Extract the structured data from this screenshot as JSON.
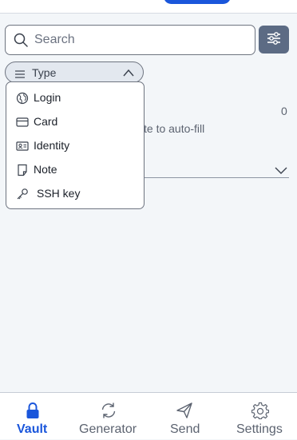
{
  "search": {
    "placeholder": "Search",
    "value": ""
  },
  "filter": {
    "type_label": "Type"
  },
  "type_menu": {
    "items": [
      {
        "label": "Login",
        "icon": "globe-icon"
      },
      {
        "label": "Card",
        "icon": "credit-card-icon"
      },
      {
        "label": "Identity",
        "icon": "id-card-icon"
      },
      {
        "label": "Note",
        "icon": "note-icon"
      },
      {
        "label": "SSH key",
        "icon": "key-icon"
      }
    ]
  },
  "background": {
    "count": "0",
    "autofill_text": "te to auto-fill"
  },
  "nav": {
    "items": [
      {
        "label": "Vault",
        "icon": "lock-icon",
        "active": true
      },
      {
        "label": "Generator",
        "icon": "refresh-icon",
        "active": false
      },
      {
        "label": "Send",
        "icon": "send-icon",
        "active": false
      },
      {
        "label": "Settings",
        "icon": "gear-icon",
        "active": false
      }
    ]
  },
  "colors": {
    "accent": "#1a56db",
    "filter_button": "#5c6b84",
    "muted_text": "#5c6370"
  }
}
